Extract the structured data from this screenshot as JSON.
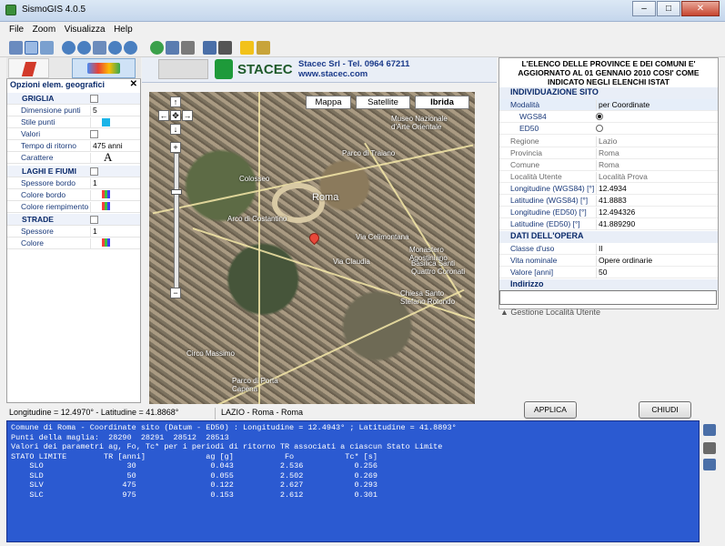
{
  "window": {
    "title": "SismoGIS 4.0.5"
  },
  "menu": [
    "File",
    "Zoom",
    "Visualizza",
    "Help"
  ],
  "header": {
    "company": "Stacec Srl - Tel. 0964 67211",
    "url": "www.stacec.com",
    "logo_text": "STACEC"
  },
  "left_panel": {
    "title": "Opzioni elem. geografici",
    "rows": [
      {
        "label": "GRIGLIA",
        "type": "section"
      },
      {
        "label": "Dimensione punti",
        "value": "5"
      },
      {
        "label": "Stile punti",
        "swatch": "#1ab4e8"
      },
      {
        "label": "Valori",
        "type": "check"
      },
      {
        "label": "Tempo di ritorno",
        "value": "475 anni"
      },
      {
        "label": "Carattere",
        "value": "A"
      },
      {
        "label": "LAGHI E FIUMI",
        "type": "section"
      },
      {
        "label": "Spessore bordo",
        "value": "1"
      },
      {
        "label": "Colore bordo",
        "type": "grid"
      },
      {
        "label": "Colore riempimento",
        "type": "grid"
      },
      {
        "label": "STRADE",
        "type": "section"
      },
      {
        "label": "Spessore",
        "value": "1"
      },
      {
        "label": "Colore",
        "type": "grid"
      }
    ]
  },
  "map": {
    "types": [
      "Mappa",
      "Satellite",
      "Ibrida"
    ],
    "selected_type": "Ibrida",
    "labels": [
      "Roma",
      "Colosseo",
      "Parco di Traiano",
      "Arco di Costantino",
      "Via Claudia",
      "Via Celimontana",
      "Basilica Santi Quattro Coronati",
      "Museo Nazionale d'Arte Orientale",
      "Circo Massimo",
      "Parco di Porta Capena",
      "Chiesa Santo Stefano Rotondo",
      "Monastero Agostiniano"
    ]
  },
  "status": {
    "coords": "Longitudine = 12.4970° - Latitudine = 41.8868°",
    "place": "LAZIO - Roma - Roma"
  },
  "right_panel": {
    "header": "L'ELENCO DELLE PROVINCE E DEI COMUNI E' AGGIORNATO AL 01 GENNAIO 2010 COSI' COME INDICATO NEGLI ELENCHI ISTAT",
    "site_section": "INDIVIDUAZIONE SITO",
    "modalita_label": "Modalità",
    "modalita_value": "per Coordinate",
    "wgs84": "WGS84",
    "ed50": "ED50",
    "rows": [
      {
        "k": "Regione",
        "v": "Lazio",
        "grey": true
      },
      {
        "k": "Provincia",
        "v": "Roma",
        "grey": true
      },
      {
        "k": "Comune",
        "v": "Roma",
        "grey": true
      },
      {
        "k": "Località Utente",
        "v": "Località Prova",
        "grey": true
      },
      {
        "k": "Longitudine (WGS84) [°]",
        "v": "12.4934"
      },
      {
        "k": "Latitudine (WGS84) [°]",
        "v": "41.8883"
      },
      {
        "k": "Longitudine (ED50) [°]",
        "v": "12.494326"
      },
      {
        "k": "Latitudine (ED50) [°]",
        "v": "41.889290"
      }
    ],
    "work_section": "DATI DELL'OPERA",
    "work_rows": [
      {
        "k": "Classe d'uso",
        "v": "II"
      },
      {
        "k": "Vita nominale",
        "v": "Opere ordinarie"
      },
      {
        "k": "Valore [anni]",
        "v": "50"
      }
    ],
    "indirizzo": "Indirizzo",
    "gestione": "Gestione Località Utente",
    "apply": "APPLICA",
    "close": "CHIUDI"
  },
  "console": {
    "lines": [
      "Comune di Roma - Coordinate sito (Datum - ED50) : Longitudine = 12.4943° ; Latitudine = 41.8893°",
      "",
      "Punti della maglia:  28290  28291  28512  28513",
      "",
      "Valori dei parametri ag, Fo, Tc* per i periodi di ritorno TR associati a ciascun Stato Limite",
      "STATO LIMITE        TR [anni]             ag [g]           Fo           Tc* [s]",
      "    SLO                  30                0.043          2.536           0.256",
      "    SLD                  50                0.055          2.502           0.269",
      "    SLV                 475                0.122          2.627           0.293",
      "    SLC                 975                0.153          2.612           0.301"
    ]
  }
}
